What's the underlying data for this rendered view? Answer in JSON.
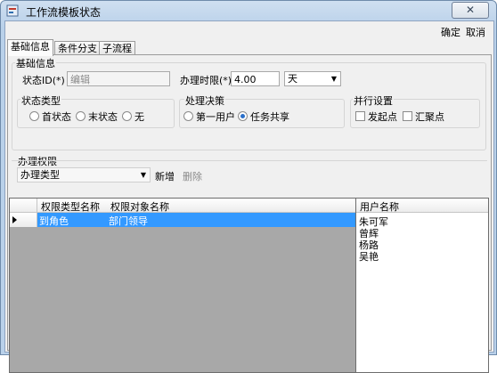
{
  "window": {
    "title": "工作流模板状态",
    "close_glyph": "✕"
  },
  "menu": {
    "confirm": "确定",
    "cancel": "取消"
  },
  "tabs": [
    {
      "label": "基础信息",
      "active": true
    },
    {
      "label": "条件分支",
      "active": false
    },
    {
      "label": "子流程",
      "active": false
    }
  ],
  "basic_info": {
    "title": "基础信息",
    "state_id_label": "状态ID(*)",
    "state_id_value": "编辑",
    "time_limit_label": "办理时限(*)",
    "time_limit_value": "4.00",
    "time_unit": "天"
  },
  "state_type": {
    "title": "状态类型",
    "options": [
      "首状态",
      "末状态",
      "无"
    ],
    "selected": null
  },
  "decision": {
    "title": "处理决策",
    "options": [
      "第一用户",
      "任务共享"
    ],
    "selected": "任务共享"
  },
  "parallel": {
    "title": "并行设置",
    "options": [
      "发起点",
      "汇聚点"
    ]
  },
  "permission": {
    "title": "办理权限",
    "type_placeholder": "办理类型",
    "add_label": "新增",
    "delete_label": "删除",
    "columns": [
      "权限类型名称",
      "权限对象名称"
    ],
    "rows": [
      {
        "type_name": "到角色",
        "object_name": "部门领导"
      }
    ],
    "user_header": "用户名称",
    "users": [
      "朱可军",
      "曾辉",
      "杨路",
      "吴艳"
    ]
  },
  "colors": {
    "selection": "#3399ff",
    "radio_checked": "#2a6fc9"
  }
}
